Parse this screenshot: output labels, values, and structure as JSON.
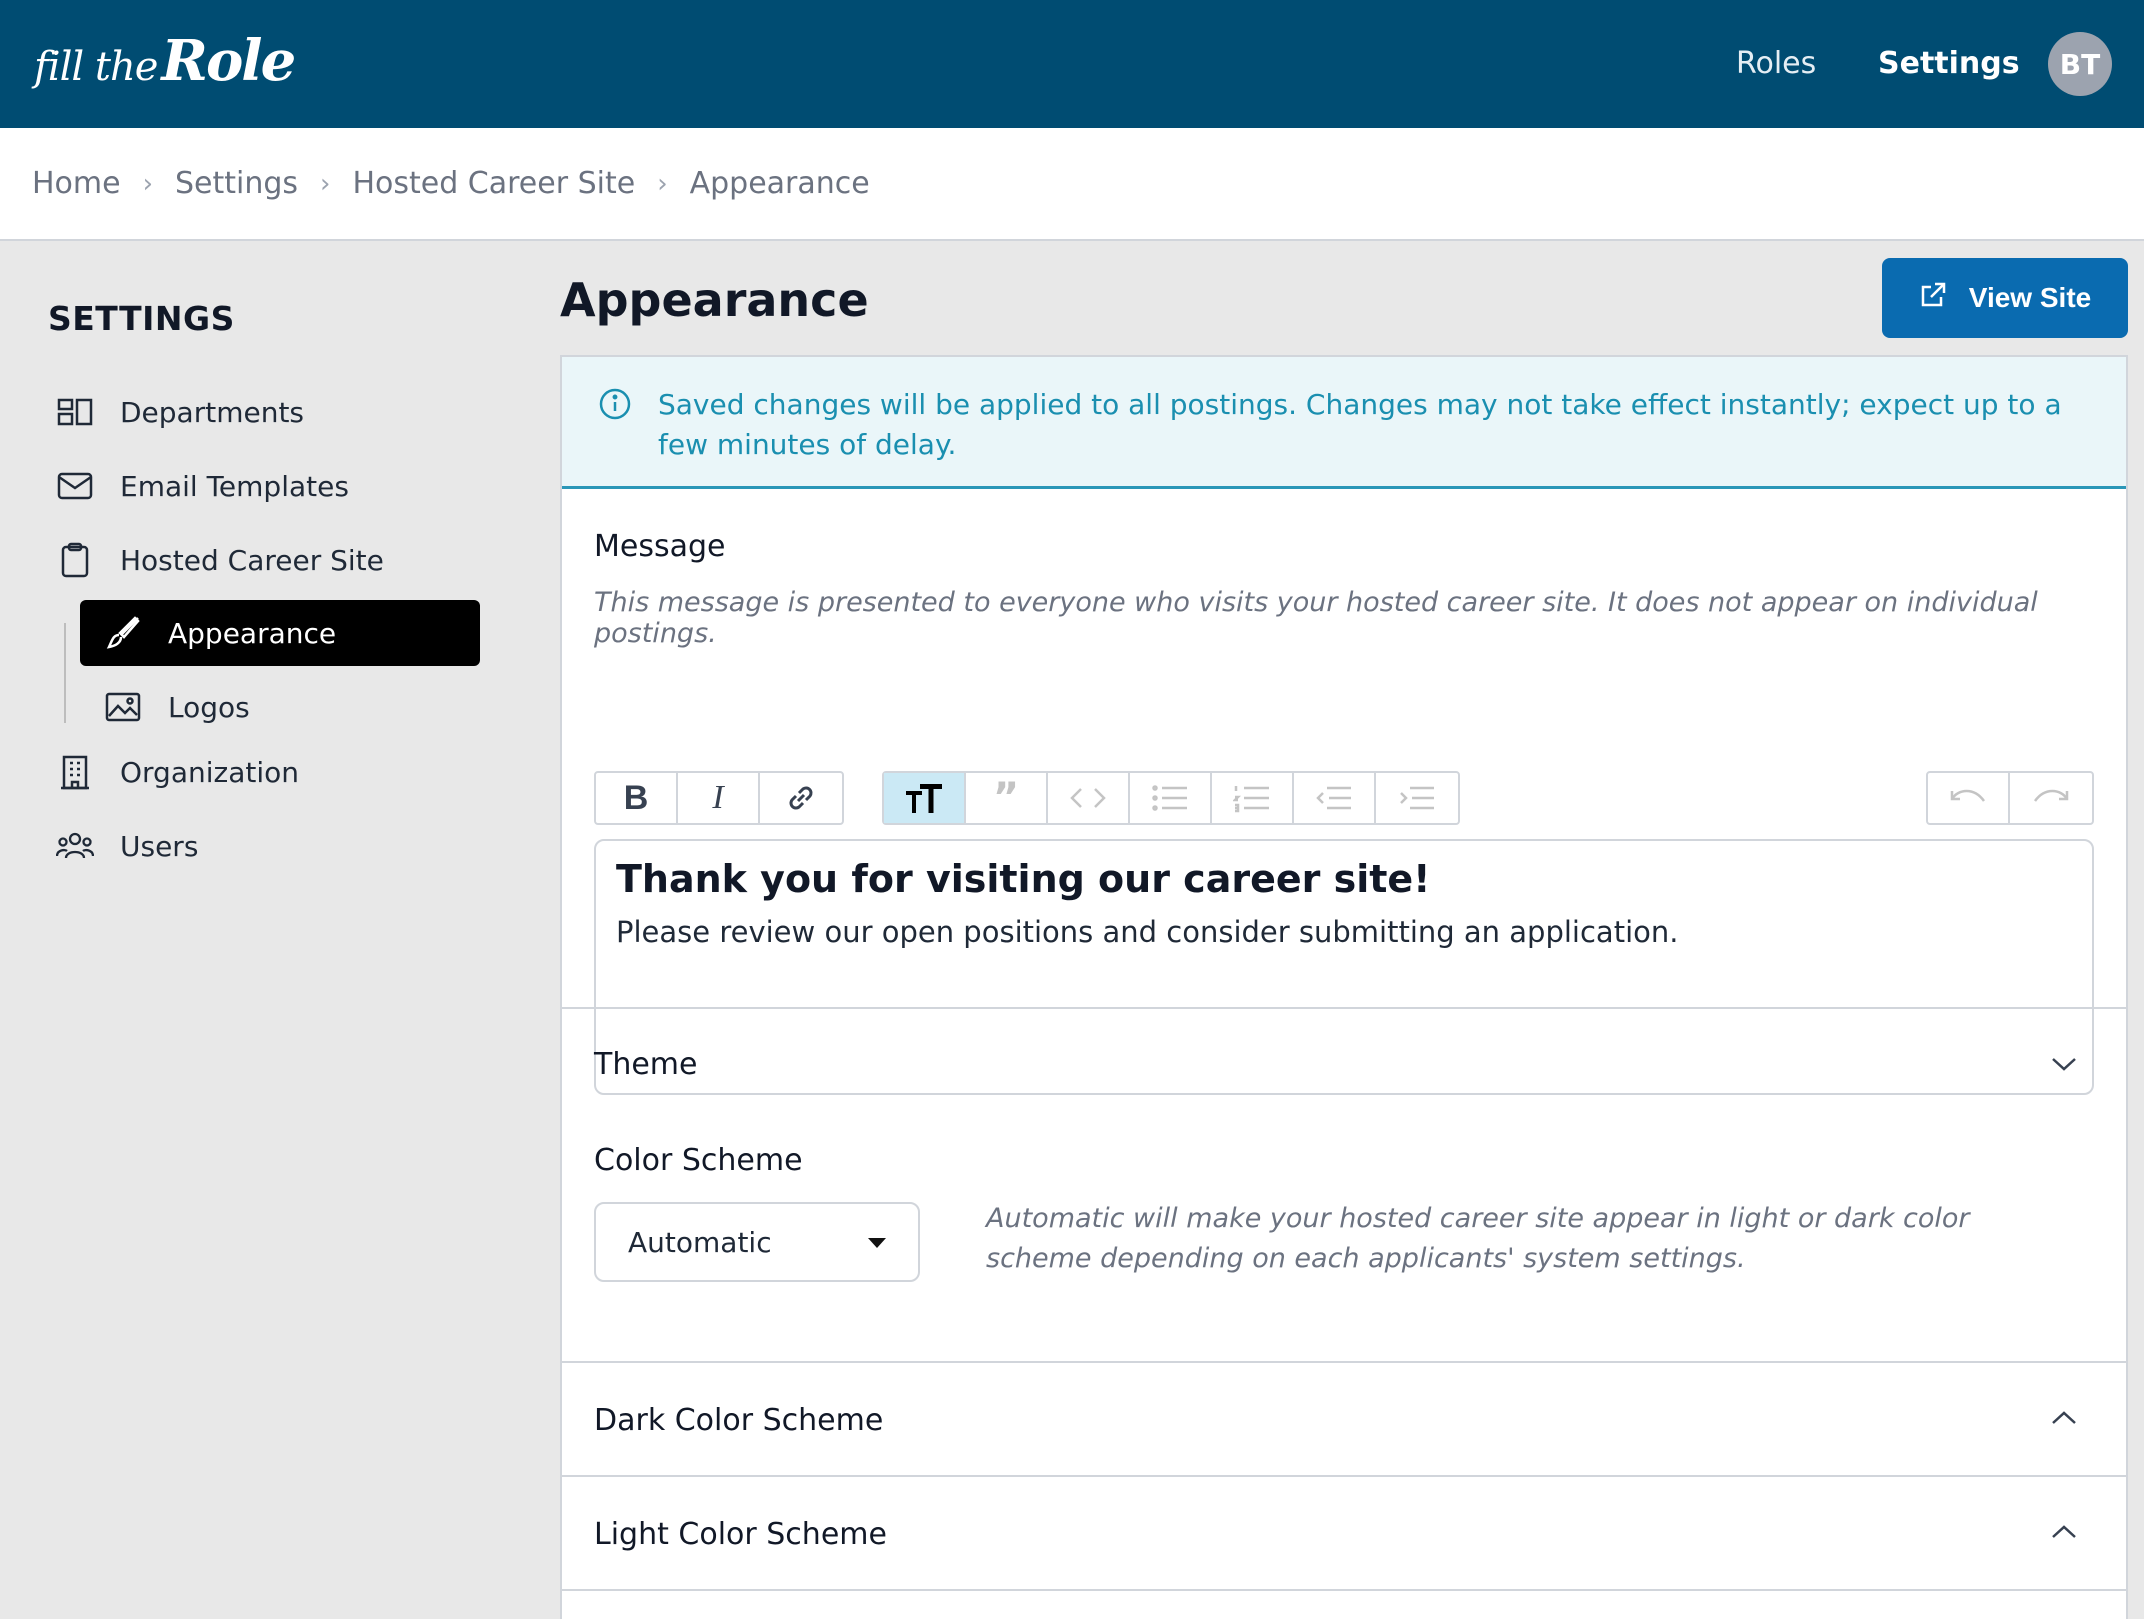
{
  "header": {
    "logo_small": "fill the",
    "logo_big": "Role",
    "nav_roles": "Roles",
    "nav_settings": "Settings",
    "avatar_initials": "BT"
  },
  "breadcrumb": [
    "Home",
    "Settings",
    "Hosted Career Site",
    "Appearance"
  ],
  "sidebar": {
    "title": "SETTINGS",
    "items": [
      {
        "label": "Departments",
        "icon": "departments-icon"
      },
      {
        "label": "Email Templates",
        "icon": "envelope-icon"
      },
      {
        "label": "Hosted Career Site",
        "icon": "clipboard-icon"
      },
      {
        "label": "Appearance",
        "icon": "paintbrush-icon",
        "active": true
      },
      {
        "label": "Logos",
        "icon": "image-icon"
      },
      {
        "label": "Organization",
        "icon": "building-icon"
      },
      {
        "label": "Users",
        "icon": "users-icon"
      }
    ]
  },
  "main": {
    "title": "Appearance",
    "view_site_label": "View Site",
    "alert_text": "Saved changes will be applied to all postings. Changes may not take effect instantly; expect up to a few minutes of delay.",
    "message": {
      "label": "Message",
      "hint": "This message is presented to everyone who visits your hosted career site. It does not appear on individual postings.",
      "heading": "Thank you for visiting our career site!",
      "body": "Please review our open positions and consider submitting an application."
    },
    "theme": {
      "label": "Theme",
      "color_scheme_label": "Color Scheme",
      "color_scheme_value": "Automatic",
      "color_scheme_hint": "Automatic will make your hosted career site appear in light or dark color scheme depending on each applicants' system settings."
    },
    "dark_scheme_label": "Dark Color Scheme",
    "light_scheme_label": "Light Color Scheme"
  },
  "colors": {
    "topbar": "#004c72",
    "primary_button": "#0a6bb0",
    "alert_text": "#1a8fb0",
    "alert_bg": "#eaf6f9"
  }
}
